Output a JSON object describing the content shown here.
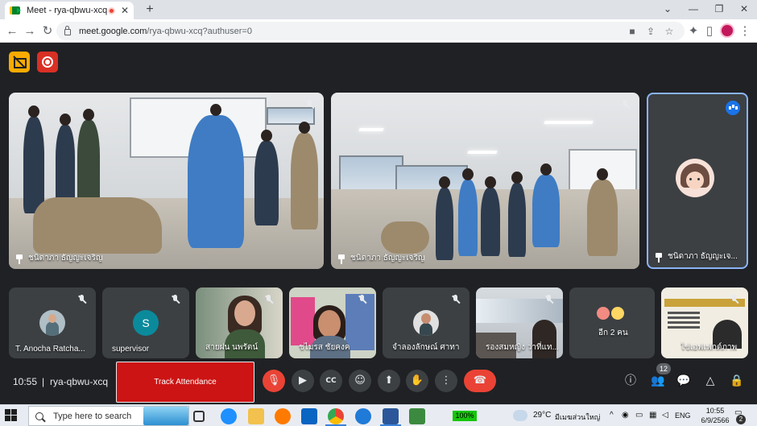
{
  "browser": {
    "tab_title": "Meet - rya-qbwu-xcq",
    "tab_close": "✕",
    "new_tab": "+",
    "url_host": "meet.google.com",
    "url_path": "/rya-qbwu-xcq?authuser=0",
    "window_controls": {
      "minimize": "—",
      "maximize": "❐",
      "close": "✕",
      "collapse": "⌄"
    }
  },
  "main_tiles": [
    {
      "name": "ชนิดาภา ธัญญะเจริญ"
    },
    {
      "name": "ชนิดาภา ธัญญะเจริญ"
    },
    {
      "name": "ชนิดาภา ธัญญะเจ..."
    }
  ],
  "thumbnails": [
    {
      "name": "T. Anocha Ratcha..."
    },
    {
      "name": "supervisor",
      "initial": "S"
    },
    {
      "name": "สายฝน นพรัตน์"
    },
    {
      "name": "ชไมรส ชัยคงค"
    },
    {
      "name": "จำลองลักษณ์ ศาทา"
    },
    {
      "name": "รองสมหญิง ว่าที่แท..."
    },
    {
      "name": "อีก 2 คน"
    },
    {
      "name": "ไข่เอฟเฟกต์ภาพ"
    }
  ],
  "controls": {
    "time": "10:55",
    "divider": "|",
    "meeting_code": "rya-qbwu-xcq",
    "track_attendance": "Track Attendance",
    "cc_label": "CC",
    "people_count": "12",
    "icons": {
      "mic": "mic-off-icon",
      "camera": "camera-icon",
      "captions": "captions-icon",
      "emoji": "emoji-icon",
      "present": "present-icon",
      "hand": "raise-hand-icon",
      "more": "more-vert-icon",
      "end": "call-end-icon"
    }
  },
  "taskbar": {
    "search_placeholder": "Type here to search",
    "battery": "100%",
    "temperature": "29°C",
    "weather": "มีเมฆส่วนใหญ่",
    "language": "ENG",
    "clock_time": "10:55",
    "clock_date": "6/9/2566",
    "notifications": "2"
  },
  "colors": {
    "meet_bg": "#202124",
    "tile_bg": "#3c4043",
    "danger": "#ea4335",
    "active_speaker": "#8ab4f8",
    "attendance": "#cc1414"
  }
}
